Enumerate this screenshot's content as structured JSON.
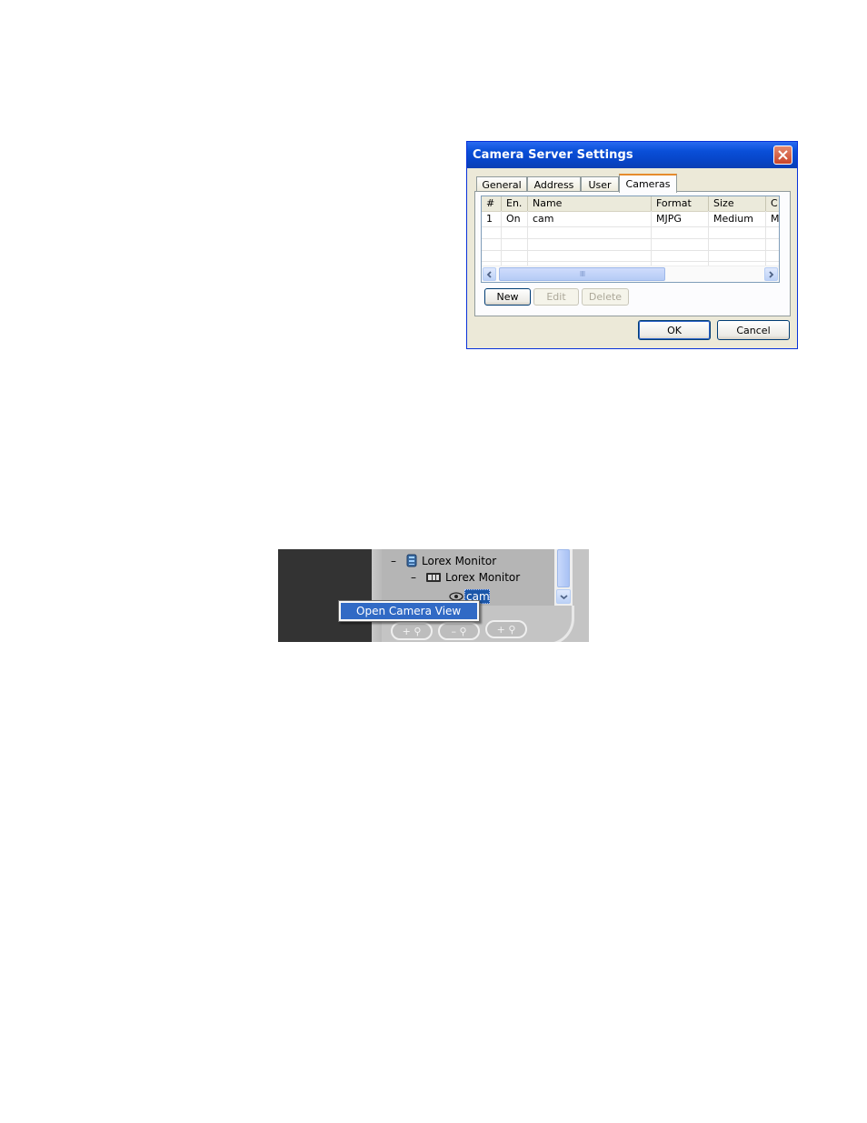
{
  "dialog": {
    "title": "Camera Server Settings",
    "tabs": [
      {
        "label": "General",
        "active": false
      },
      {
        "label": "Address",
        "active": false
      },
      {
        "label": "User",
        "active": false
      },
      {
        "label": "Cameras",
        "active": true
      }
    ],
    "table": {
      "columns": [
        "#",
        "En.",
        "Name",
        "Format",
        "Size",
        "C"
      ],
      "rows": [
        [
          "1",
          "On",
          "cam",
          "MJPG",
          "Medium",
          "M"
        ]
      ]
    },
    "scroll_grip": "IIII",
    "buttons": {
      "new": "New",
      "edit": "Edit",
      "delete": "Delete",
      "ok": "OK",
      "cancel": "Cancel"
    }
  },
  "tree": {
    "items": [
      {
        "expander": "–",
        "label": "Lorex Monitor"
      },
      {
        "expander": "–",
        "label": "Lorex Monitor"
      },
      {
        "label": "cam"
      }
    ],
    "zoom_buttons": [
      "+ ⚲",
      "– ⚲",
      "+ ⚲"
    ]
  },
  "context_menu": {
    "items": [
      "Open Camera View"
    ]
  },
  "colors": {
    "titlebar": "#0a4fd8",
    "selection": "#316ac5",
    "dialog_face": "#ece9d8"
  }
}
